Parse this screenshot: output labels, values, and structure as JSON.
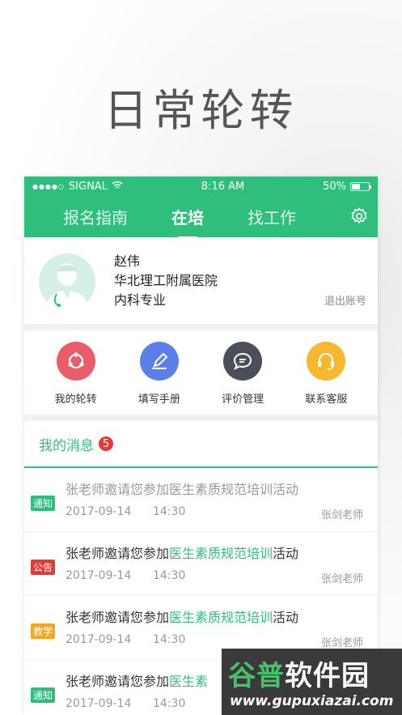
{
  "headline": "日常轮转",
  "status_bar": {
    "carrier": "SIGNAL",
    "time": "8:16 AM",
    "battery": "50%",
    "battery_level": 0.5
  },
  "tabs": [
    {
      "label": "报名指南",
      "active": false
    },
    {
      "label": "在培",
      "active": true
    },
    {
      "label": "找工作",
      "active": false
    }
  ],
  "profile": {
    "name": "赵伟",
    "hospital": "华北理工附属医院",
    "major": "内科专业",
    "logout_label": "退出账号"
  },
  "quick_actions": [
    {
      "label": "我的轮转",
      "icon": "rotation-icon",
      "color": "#e95c6a"
    },
    {
      "label": "填写手册",
      "icon": "pencil-icon",
      "color": "#5b7fe8"
    },
    {
      "label": "评价管理",
      "icon": "chat-icon",
      "color": "#4b4f5c"
    },
    {
      "label": "联系客服",
      "icon": "headset-icon",
      "color": "#f5b82e"
    }
  ],
  "messages": {
    "title": "我的消息",
    "count": "5",
    "items": [
      {
        "tag": "通知",
        "tag_color": "#2fbf7c",
        "text_pre": "张老师邀请您参加医生素质规范培训活动",
        "highlight": "",
        "text_post": "",
        "date": "2017-09-14",
        "time": "14:30",
        "from": "张剑老师",
        "read": true
      },
      {
        "tag": "公告",
        "tag_color": "#e53935",
        "text_pre": "张老师邀请您参加",
        "highlight": "医生素质规范培训",
        "text_post": "活动",
        "date": "2017-09-14",
        "time": "14:30",
        "from": "张剑老师",
        "read": false
      },
      {
        "tag": "教学",
        "tag_color": "#f5a623",
        "text_pre": "张老师邀请您参加",
        "highlight": "医生素质规范培训",
        "text_post": "活动",
        "date": "2017-09-14",
        "time": "14:30",
        "from": "张剑老师",
        "read": false
      },
      {
        "tag": "通知",
        "tag_color": "#2fbf7c",
        "text_pre": "张老师邀请您参加",
        "highlight": "医生素",
        "text_post": "",
        "date": "2017-09-14",
        "time": "14:30",
        "from": "",
        "read": false
      }
    ]
  },
  "watermark": {
    "title_a": "谷普",
    "title_b": "软件园",
    "url": "www.gupuxiazai.com"
  },
  "colors": {
    "brand": "#2fbf7c",
    "alert": "#e53935"
  }
}
